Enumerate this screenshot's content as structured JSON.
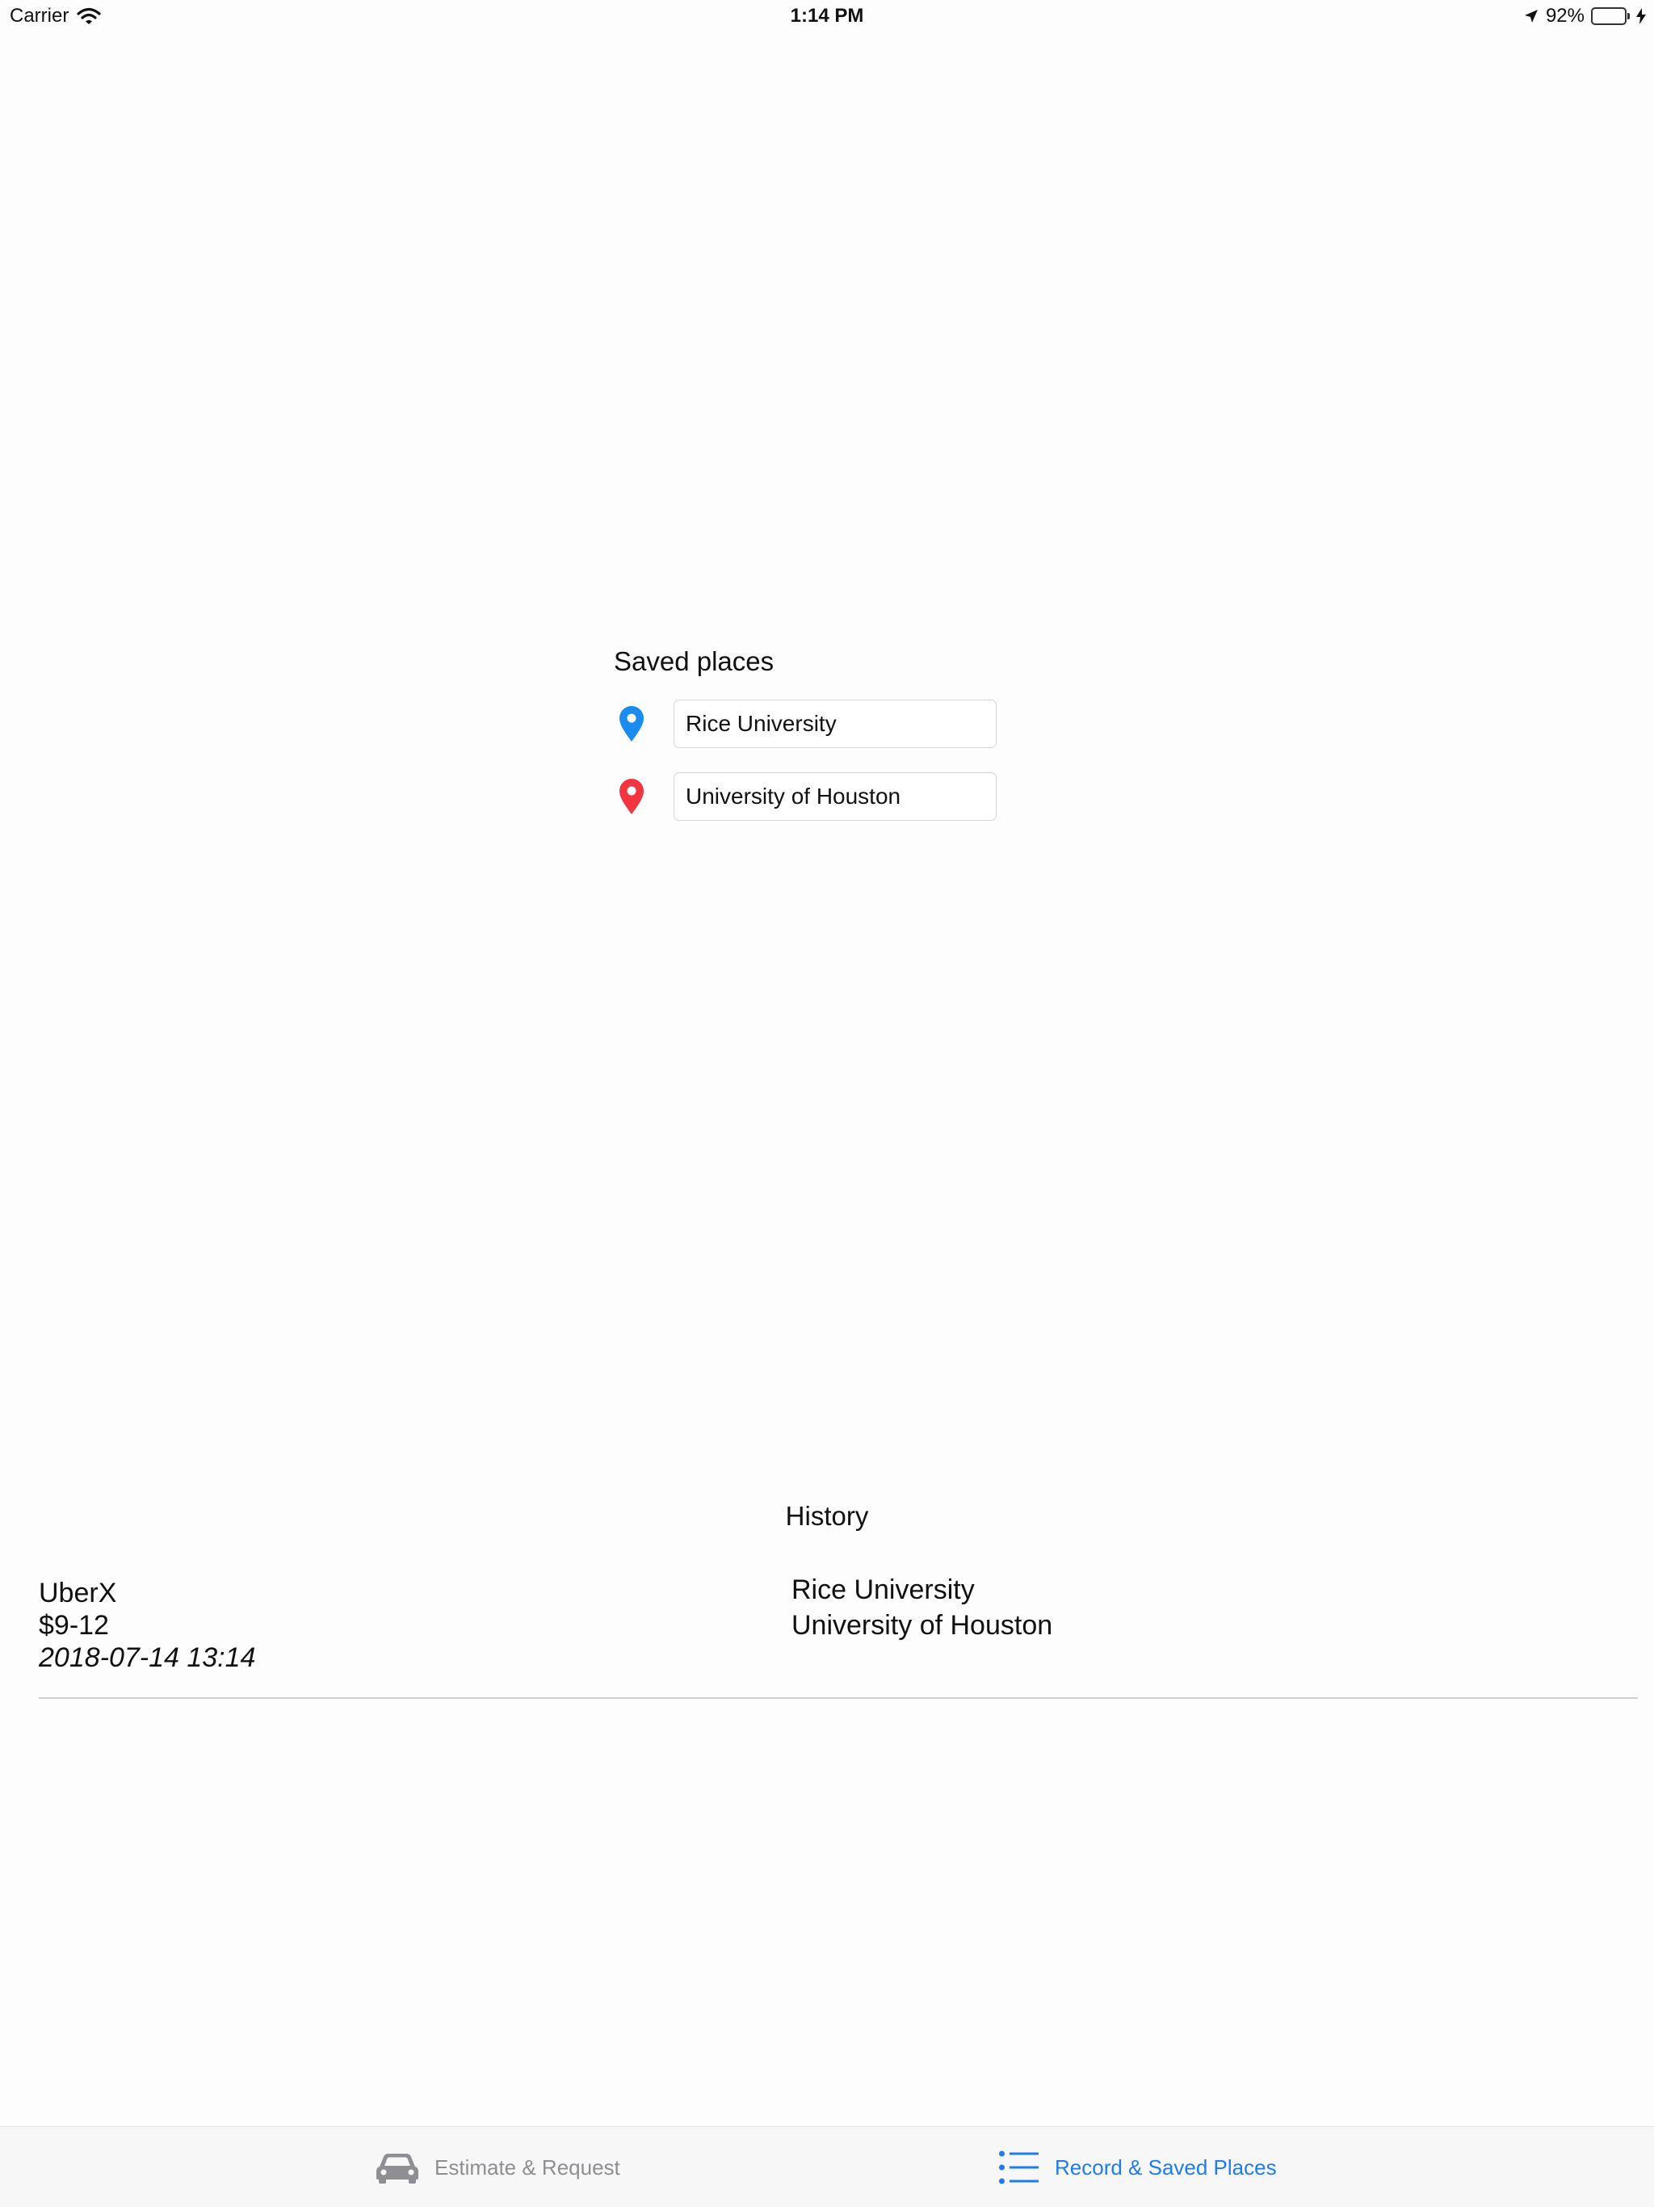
{
  "status_bar": {
    "carrier": "Carrier",
    "time": "1:14 PM",
    "battery_percent": "92%",
    "battery_level": 0.92,
    "battery_color": "#3ec94a"
  },
  "saved_places": {
    "title": "Saved places",
    "items": [
      {
        "value": "Rice University",
        "icon": "blue-location-pin-icon",
        "color": "#1a8cf0"
      },
      {
        "value": "University of Houston",
        "icon": "red-location-pin-icon",
        "color": "#f2353e"
      }
    ]
  },
  "history": {
    "title": "History",
    "entries": [
      {
        "product": "UberX",
        "price": "$9-12",
        "datetime": "2018-07-14 13:14",
        "start": "Rice University",
        "end": "University of Houston"
      }
    ]
  },
  "tab_bar": {
    "tabs": [
      {
        "label": "Estimate & Request",
        "icon": "car-icon",
        "selected": false
      },
      {
        "label": "Record & Saved Places",
        "icon": "list-icon",
        "selected": true
      }
    ],
    "active_color": "#1e7cf0",
    "inactive_color": "#8e8e93"
  }
}
